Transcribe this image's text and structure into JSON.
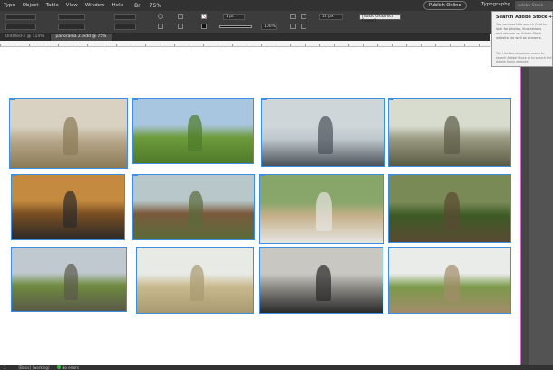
{
  "menubar": {
    "items": [
      "Type",
      "Object",
      "Table",
      "View",
      "Window",
      "Help"
    ],
    "br_label": "Br",
    "zoom": "75%",
    "publish_label": "Publish Online",
    "workspace": "Typography",
    "stock_placeholder": "Adobe Stock"
  },
  "control": {
    "stroke_weight": "1 pt",
    "percent": "100%",
    "size": "12 px",
    "frame_style": "[Basic Graphics Frame]"
  },
  "tabs": [
    {
      "label": "Untitled-2 @ 114%"
    },
    {
      "label": "panorama 2.indd @ 75%"
    }
  ],
  "stock_popup": {
    "title": "Search Adobe Stock + Adobe",
    "body": "You can use this search field to look for photos, illustrations and vectors on Adobe Stock website, as well as answers.",
    "tip": "Tip: Use the dropdown menu to search Adobe Stock or to search the Adobe Stock website."
  },
  "status": {
    "page": "1",
    "profile": "[Basic] (working)",
    "errors": "No errors"
  },
  "photos": [
    {
      "name": "woman-hands-toward-camera",
      "colors": [
        "#d9d2c2",
        "#b8a88c",
        "#8a7a55"
      ]
    },
    {
      "name": "woman-sitting-on-grass",
      "colors": [
        "#a9c6e0",
        "#6d9b3b",
        "#4f7a2a"
      ]
    },
    {
      "name": "woman-on-stool-studio",
      "colors": [
        "#cfd6da",
        "#bfc8cc",
        "#4a5158"
      ]
    },
    {
      "name": "man-in-greenhouse",
      "colors": [
        "#d8dccf",
        "#9a9a82",
        "#5b5a44"
      ]
    },
    {
      "name": "two-people-at-table",
      "colors": [
        "#c48a3f",
        "#7a4f23",
        "#2c2a28"
      ]
    },
    {
      "name": "goats-in-field",
      "colors": [
        "#b8c7c9",
        "#7a5a3c",
        "#5a6b3a"
      ]
    },
    {
      "name": "woman-dancing-with-goats",
      "colors": [
        "#89a66a",
        "#c5b08a",
        "#e6e6e2"
      ]
    },
    {
      "name": "man-in-vegetable-garden",
      "colors": [
        "#7a8a56",
        "#3d5a25",
        "#5a4a32"
      ]
    },
    {
      "name": "people-by-old-building",
      "colors": [
        "#bfc9cf",
        "#6f8a3f",
        "#5a5a4a"
      ]
    },
    {
      "name": "field-with-farmhouse",
      "colors": [
        "#e8eae6",
        "#c9b98e",
        "#a89a70"
      ]
    },
    {
      "name": "dancer-in-studio",
      "colors": [
        "#c9c7c2",
        "#8e8c86",
        "#2a2a2a"
      ]
    },
    {
      "name": "tree-and-hut",
      "colors": [
        "#e9ece8",
        "#7c9a4a",
        "#a28b6a"
      ]
    }
  ]
}
